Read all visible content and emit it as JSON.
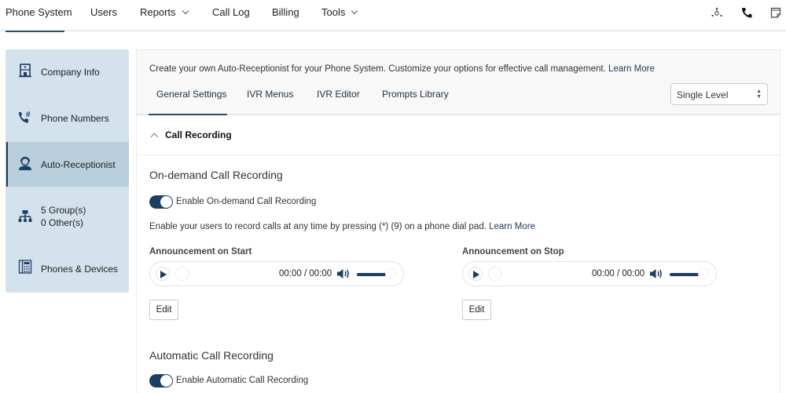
{
  "topnav": {
    "items": [
      {
        "label": "Phone System",
        "active": true,
        "dropdown": false
      },
      {
        "label": "Users",
        "dropdown": false
      },
      {
        "label": "Reports",
        "dropdown": true
      },
      {
        "label": "Call Log",
        "dropdown": false
      },
      {
        "label": "Billing",
        "dropdown": false
      },
      {
        "label": "Tools",
        "dropdown": true
      }
    ],
    "icons": [
      "network-icon",
      "phone-icon",
      "notes-icon"
    ]
  },
  "sidebar": {
    "items": [
      {
        "label": "Company Info",
        "icon": "building-icon"
      },
      {
        "label": "Phone Numbers",
        "icon": "phone-hash-icon"
      },
      {
        "label": "Auto-Receptionist",
        "icon": "receptionist-icon",
        "active": true
      },
      {
        "label_line1": "5 Group(s)",
        "label_line2": "0 Other(s)",
        "icon": "org-chart-icon"
      },
      {
        "label": "Phones & Devices",
        "icon": "desk-phone-icon"
      }
    ]
  },
  "header": {
    "intro": "Create your own Auto-Receptionist for your Phone System. Customize your options for effective call management.",
    "learn_more": "Learn More",
    "tabs": [
      "General Settings",
      "IVR Menus",
      "IVR Editor",
      "Prompts Library"
    ],
    "active_tab": "General Settings",
    "level_select": {
      "value": "Single Level"
    }
  },
  "section": {
    "title": "Call Recording",
    "expanded": true
  },
  "on_demand": {
    "heading": "On-demand Call Recording",
    "toggle_label": "Enable On-demand Call Recording",
    "enabled": true,
    "description": "Enable your users to record calls at any time by pressing (*) (9) on a phone dial pad.",
    "learn_more": "Learn More",
    "start": {
      "label": "Announcement on Start",
      "time": "00:00 / 00:00",
      "volume": 1.0,
      "edit": "Edit"
    },
    "stop": {
      "label": "Announcement on Stop",
      "time": "00:00 / 00:00",
      "volume": 1.0,
      "edit": "Edit"
    }
  },
  "automatic": {
    "heading": "Automatic Call Recording",
    "toggle_label": "Enable Automatic Call Recording",
    "enabled": true
  },
  "colors": {
    "accent": "#1c3f62",
    "sidebar_bg": "#d3e2ec",
    "sidebar_active": "#b9cfdd"
  }
}
